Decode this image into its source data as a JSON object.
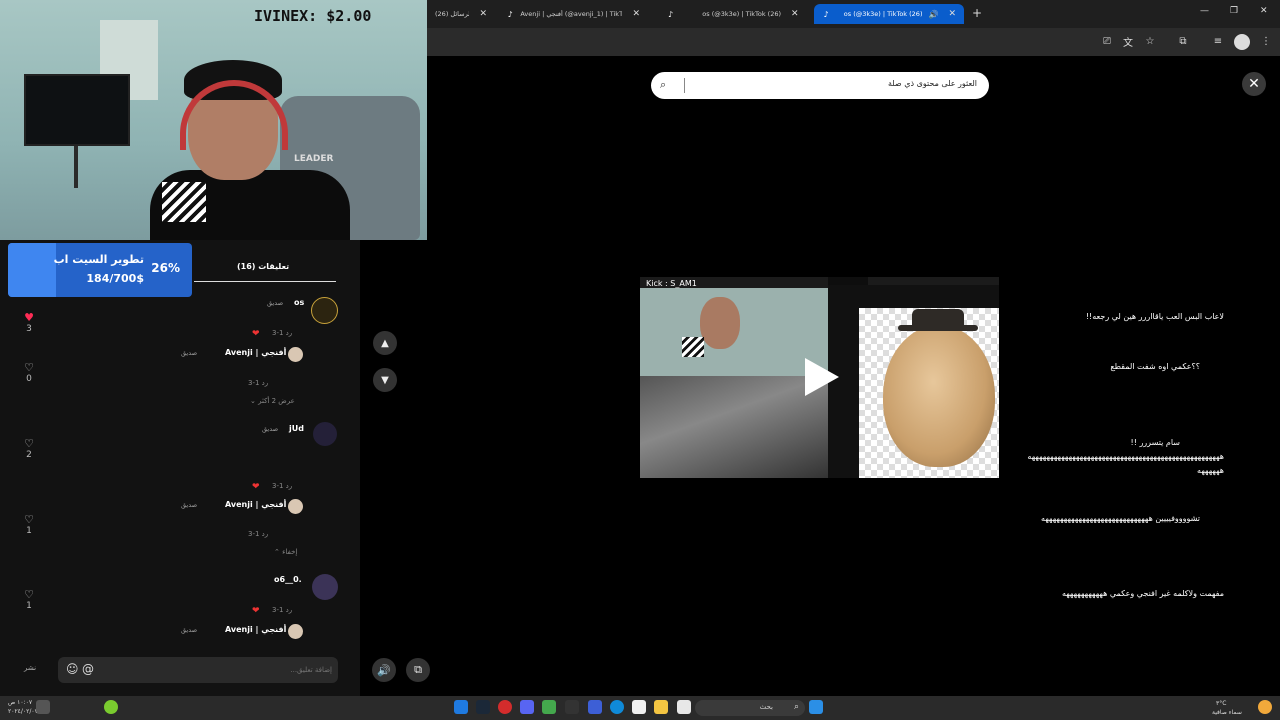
{
  "browser": {
    "tabs": [
      {
        "label": "تيك توك | الرسائل (26)"
      },
      {
        "label": "Avenji | أفنجي (@avenji_1) | TikTok (26)"
      },
      {
        "label": "os (@3k3e) | TikTok (26)"
      },
      {
        "label": "os (@3k3e) | TikTok (26)"
      }
    ],
    "new_tab": "+"
  },
  "stream_overlay": {
    "price_text": "IVINEX: $2.00",
    "chair_brand": "LEADER"
  },
  "goal": {
    "title": "تطوير السيت اب",
    "amount": "184/700$",
    "percent_text": "26%",
    "progress": 0.26
  },
  "comments_panel": {
    "tab_label": "(16) تعليقات",
    "comments": [
      {
        "name": "os",
        "sub": "صديق",
        "text": "لاعاب البس العب ياقااررر هين لي رجعه!!",
        "meta": "3-1 رد",
        "likes": "3"
      },
      {
        "name": "Avenji | أفنجي",
        "sub": "صديق",
        "text": "؟؟عكمي اوه شفت المقطع",
        "meta": "3-1 رد",
        "likes": "0"
      },
      {
        "name": "jUd",
        "sub": "صديق",
        "text": "سام يتسررر !!",
        "text2": "ههههههههههههههههههههههههههههههههههههههههههههههههههههه",
        "text3": "ههههههه",
        "meta": "3-1 رد",
        "likes": "2"
      },
      {
        "name": "Avenji | أفنجي",
        "sub": "صديق",
        "text": "تشووووفيييين هههههههههههههههههههههههههههههه",
        "meta": "3-1 رد",
        "likes": "1"
      },
      {
        "name": "o6__0.",
        "text": "مفهمت ولاكلمه غير افنجي وعكمي هههههههههههه",
        "meta": "3-1 رد",
        "likes": "1"
      },
      {
        "name": "Avenji | أفنجي",
        "sub": "صديق"
      }
    ],
    "view_more": "عرض 2 أكثر",
    "hide": "إخفاء",
    "input_placeholder": "إضافة تعليق...",
    "share_label": "نشر"
  },
  "video": {
    "search_text": "العثور على محتوى ذي صلة",
    "overlay_label": "Kick : S_AM1"
  },
  "taskbar": {
    "search_text": "بحث",
    "time": "١٠:٠٧ ص",
    "date": "٢٠٢٤/٠٢/٠٧",
    "weather_temp": "٣°C",
    "weather_desc": "سماء صافية"
  },
  "colors": {
    "accent": "#fe2c55",
    "goal_bar": "#3f86f0",
    "active_tab": "#0a5dcc"
  }
}
